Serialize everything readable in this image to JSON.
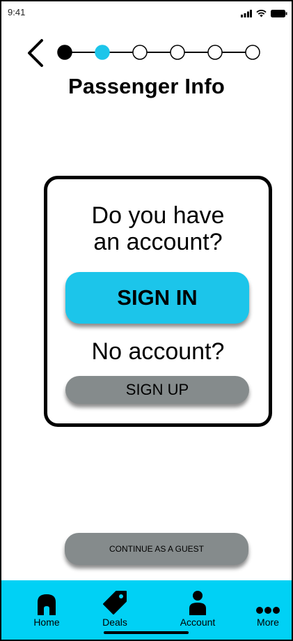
{
  "status_bar": {
    "time": "9:41",
    "signal_icon": "signal-bars-icon",
    "wifi_icon": "wifi-icon",
    "battery_icon": "battery-icon"
  },
  "header": {
    "back_icon": "chevron-left-icon",
    "title": "Passenger Info",
    "stepper": {
      "total_steps": 6,
      "completed_step": 1,
      "current_step": 2,
      "colors": {
        "completed": "#000000",
        "current": "#1cc5ea",
        "upcoming": "#ffffff"
      }
    }
  },
  "account_card": {
    "question_line1": "Do you have",
    "question_line2": "an account?",
    "sign_in_label": "SIGN IN",
    "no_account_text": "No account?",
    "sign_up_label": "SIGN UP"
  },
  "guest_button": {
    "label": "CONTINUE AS A GUEST"
  },
  "tab_bar": {
    "background": "#00d1f5",
    "items": [
      {
        "label": "Home",
        "icon": "home-icon"
      },
      {
        "label": "Deals",
        "icon": "tag-icon"
      },
      {
        "label": "Account",
        "icon": "person-icon"
      },
      {
        "label": "More",
        "icon": "more-dots-icon"
      }
    ]
  },
  "colors": {
    "accent": "#1cc5ea",
    "secondary_button": "#858b8c",
    "tab_bar": "#00d1f5"
  }
}
